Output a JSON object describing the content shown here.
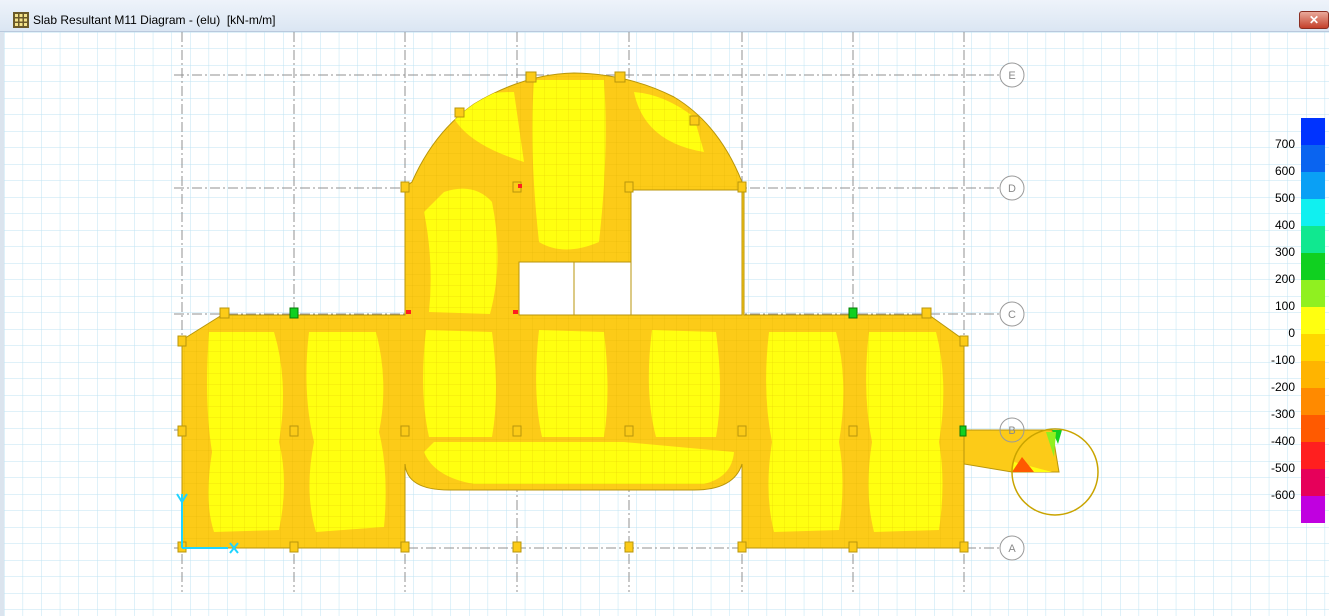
{
  "window": {
    "title": "Slab Resultant M11 Diagram - (elu)  [kN-m/m]",
    "close_glyph": "✕",
    "icon": "grid-app-icon"
  },
  "grid_lines": {
    "labels": [
      "E",
      "D",
      "C",
      "B",
      "A"
    ]
  },
  "legend": {
    "labels": [
      "700",
      "600",
      "500",
      "400",
      "300",
      "200",
      "100",
      "0",
      "-100",
      "-200",
      "-300",
      "-400",
      "-500",
      "-600"
    ],
    "colors": [
      "#0033ff",
      "#0a64f0",
      "#0aa0f5",
      "#10f0f0",
      "#10e890",
      "#10d020",
      "#90f020",
      "#ffff10",
      "#ffd700",
      "#ffb400",
      "#ff8a00",
      "#ff5a00",
      "#ff1f1f",
      "#e6005a",
      "#c000e0"
    ]
  },
  "colors": {
    "slab_fill_high": "#ffff10",
    "slab_fill_low": "#fccb18",
    "grid_background": "#a8d8ee",
    "axis_x": "#1fd4ff",
    "axis_y": "#1fd4ff"
  }
}
